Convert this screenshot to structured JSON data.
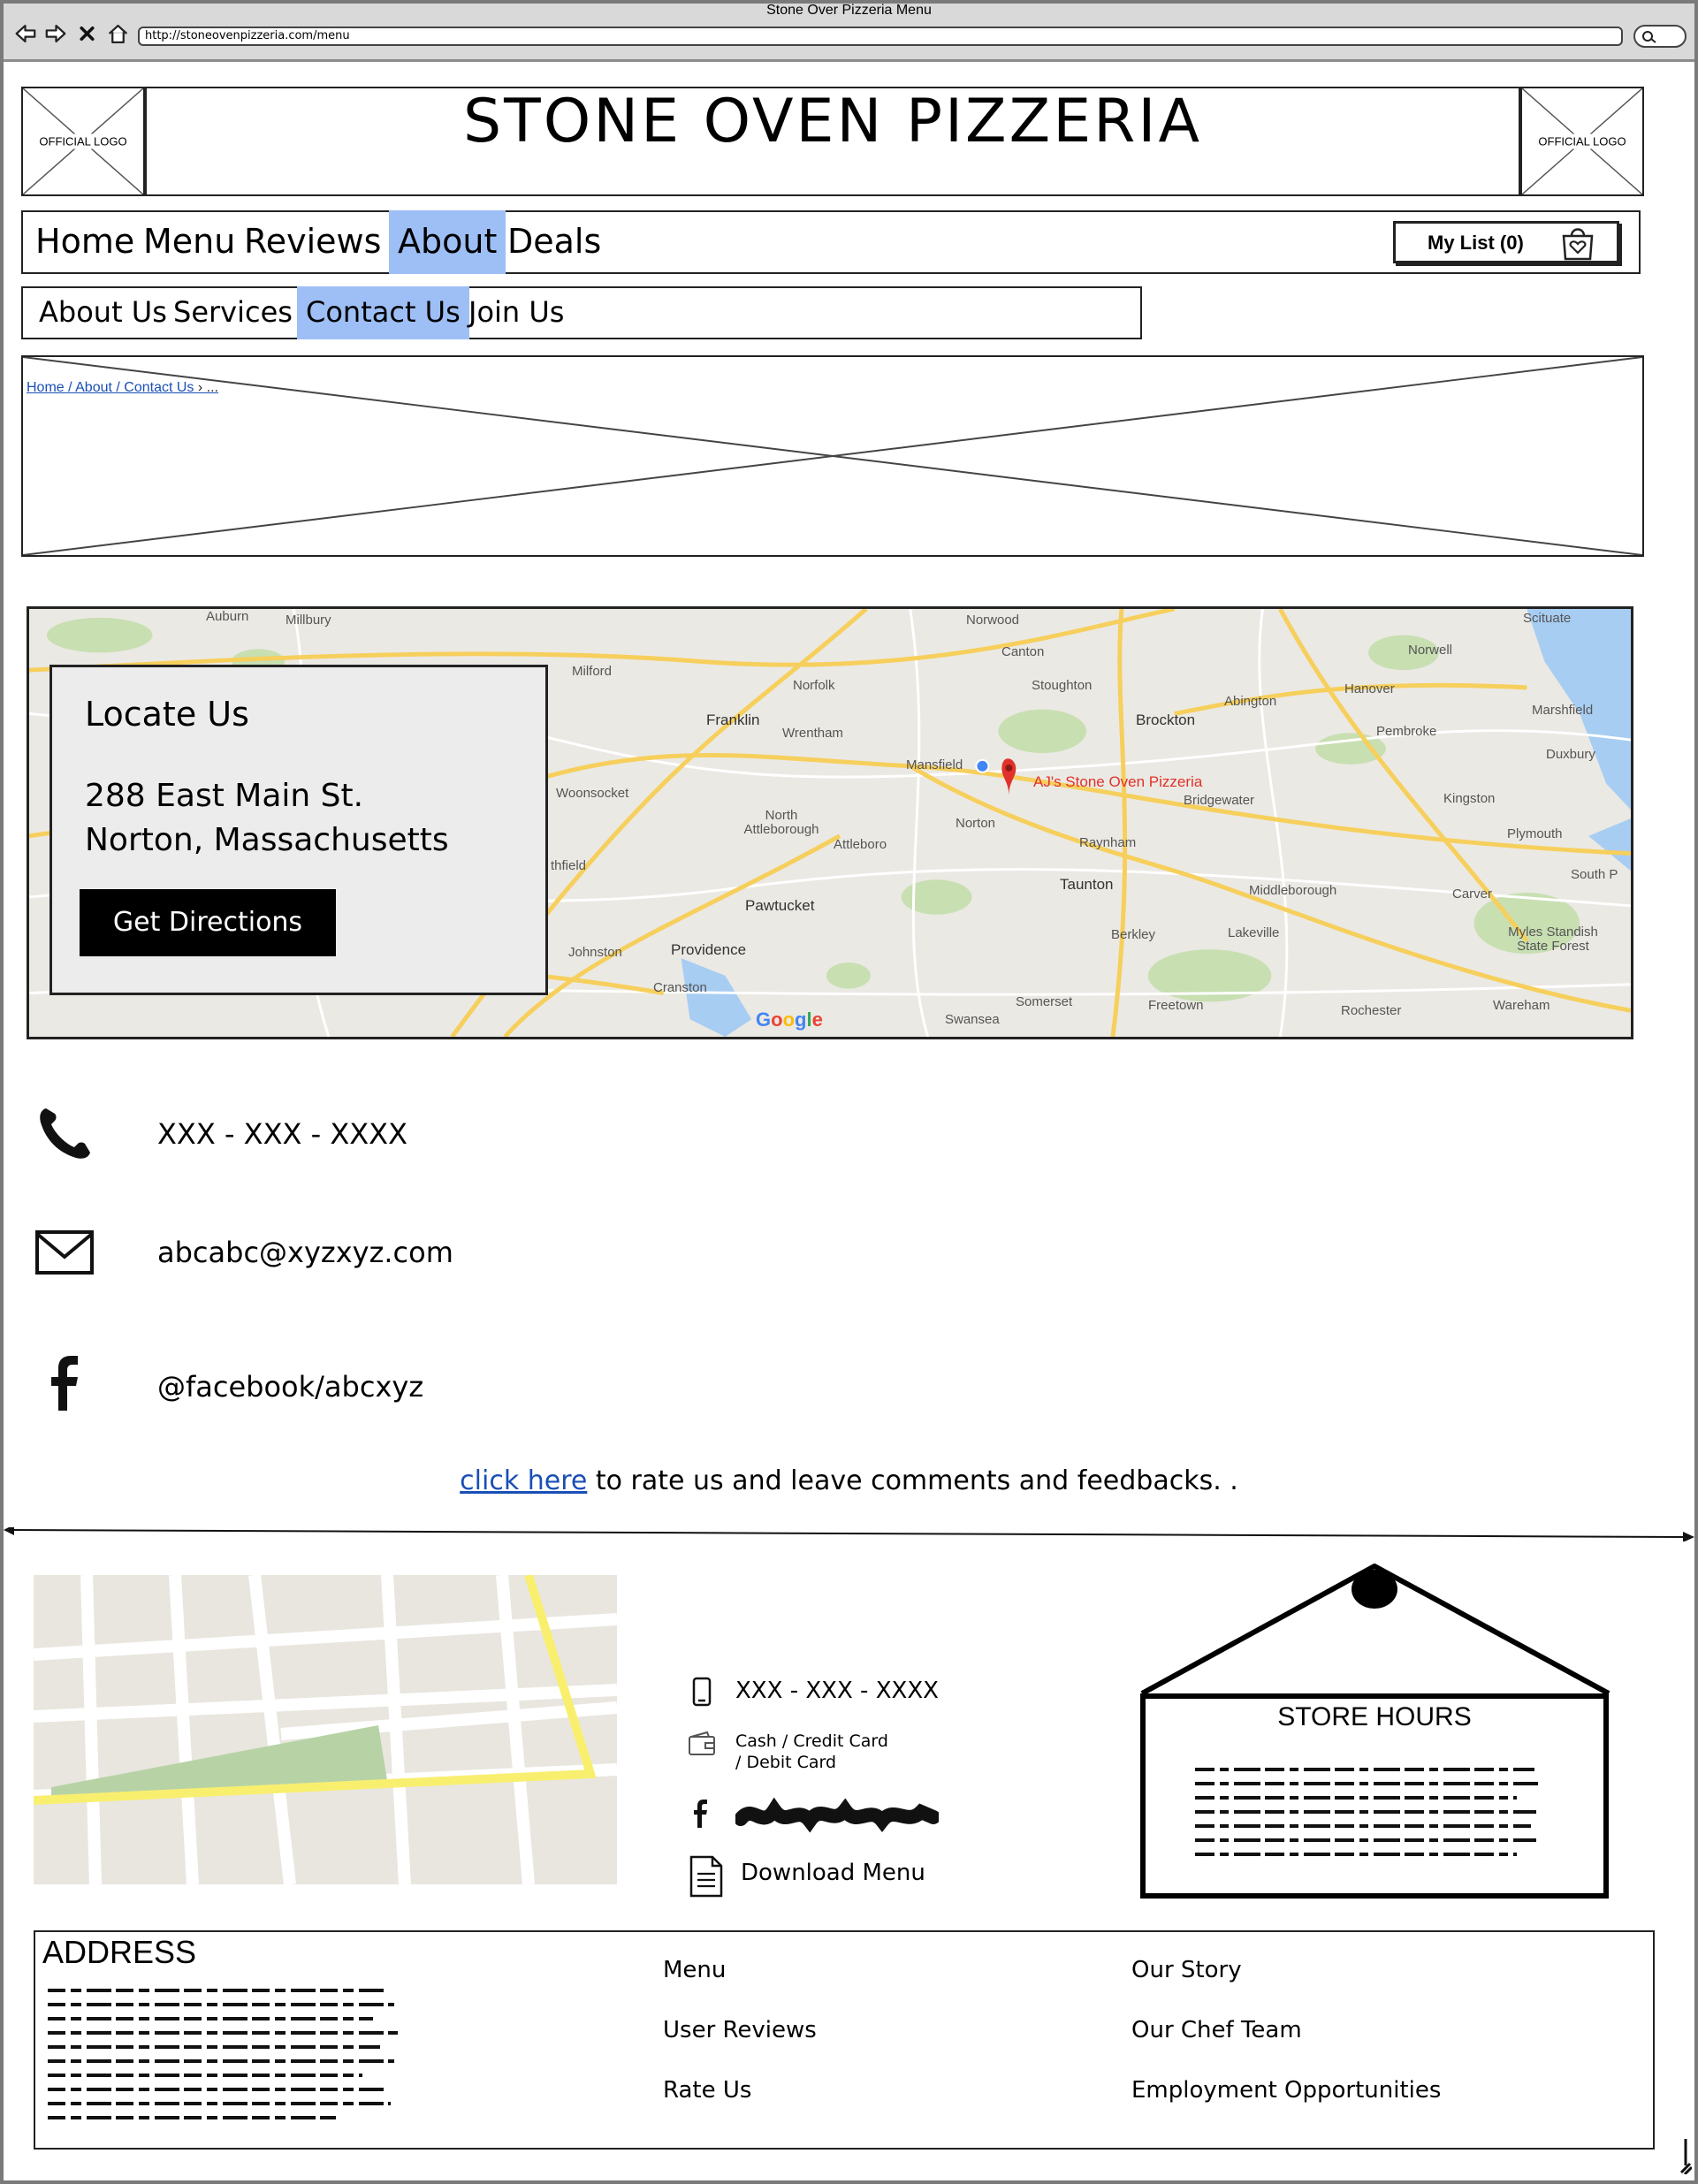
{
  "browser": {
    "window_title": "Stone Over Pizzeria Menu",
    "url": "http://stoneovenpizzeria.com/menu"
  },
  "header": {
    "logo_left_label": "OFFICIAL LOGO",
    "logo_right_label": "OFFICIAL LOGO",
    "site_title": "STONE OVEN PIZZERIA"
  },
  "main_nav": {
    "items": [
      {
        "label": "Home"
      },
      {
        "label": "Menu"
      },
      {
        "label": "Reviews"
      },
      {
        "label": "About"
      },
      {
        "label": "Deals"
      }
    ],
    "active": "About",
    "my_list_label": "My List (0)"
  },
  "sub_nav": {
    "items": [
      {
        "label": "About Us"
      },
      {
        "label": "Services"
      },
      {
        "label": "Contact Us"
      },
      {
        "label": "Join Us"
      }
    ],
    "active": "Contact Us"
  },
  "breadcrumb": {
    "text": "Home / About / Contact Us",
    "suffix": "› ..."
  },
  "map": {
    "pin_label": "AJ's Stone Oven Pizzeria",
    "brand": "Google",
    "places": [
      "Auburn",
      "Millbury",
      "Norwood",
      "Scituate",
      "Canton",
      "Norwell",
      "Milford",
      "Norfolk",
      "Stoughton",
      "Hanover",
      "Marshfield",
      "Franklin",
      "Wrentham",
      "Brockton",
      "Abington",
      "Pembroke",
      "Duxbury",
      "Mansfield",
      "Woonsocket",
      "North Attleborough",
      "Attleboro",
      "Norton",
      "Bridgewater",
      "Kingston",
      "Plymouth",
      "Raynham",
      "Pawtucket",
      "Taunton",
      "Middleborough",
      "Carver",
      "South P",
      "Providence",
      "Johnston",
      "Cranston",
      "Berkley",
      "Lakeville",
      "Myles Standish State Forest",
      "Somerset",
      "Swansea",
      "Freetown",
      "Rochester",
      "Wareham",
      "thfield"
    ]
  },
  "locate": {
    "title": "Locate Us",
    "address_line1": "288 East Main St.",
    "address_line2": "Norton, Massachusetts",
    "button": "Get Directions"
  },
  "contacts": {
    "phone": "XXX - XXX - XXXX",
    "email": "abcabc@xyzxyz.com",
    "facebook": "@facebook/abcxyz",
    "icons": [
      "phone-icon",
      "mail-icon",
      "facebook-icon"
    ]
  },
  "rate": {
    "link_text": "click here",
    "rest": " to rate us and leave comments and feedbacks. ."
  },
  "footer": {
    "phone": "XXX - XXX - XXXX",
    "payment_line1": "Cash / Credit Card",
    "payment_line2": "/ Debit Card",
    "download_menu": "Download Menu",
    "store_hours_title": "STORE HOURS",
    "address_title": "ADDRESS",
    "links_col1": [
      "Menu",
      "User Reviews",
      "Rate Us"
    ],
    "links_col2": [
      "Our Story",
      "Our Chef Team",
      "Employment Opportunities"
    ]
  },
  "colors": {
    "active_tab": "#9ebff5",
    "link": "#1a4fb5",
    "pin": "#e0322b"
  }
}
